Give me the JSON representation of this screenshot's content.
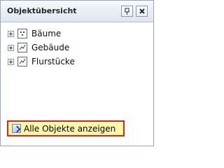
{
  "header": {
    "title": "Objektübersicht"
  },
  "tree": {
    "items": [
      {
        "label": "Bäume",
        "icon": "tree-points-icon"
      },
      {
        "label": "Gebäude",
        "icon": "building-icon"
      },
      {
        "label": "Flurstücke",
        "icon": "parcel-icon"
      }
    ]
  },
  "footer": {
    "show_all_label": "Alle Objekte anzeigen"
  }
}
